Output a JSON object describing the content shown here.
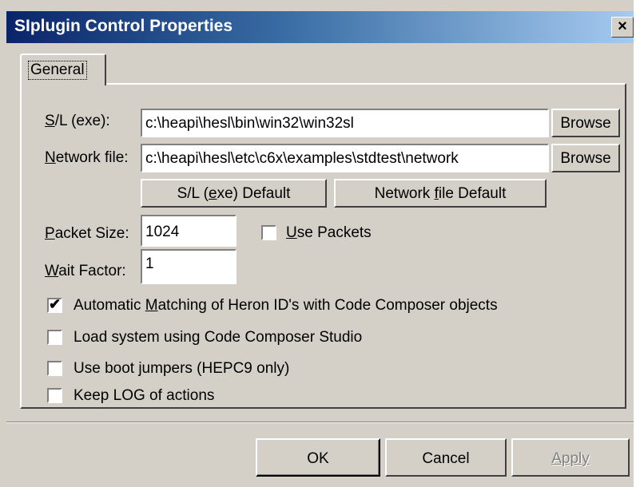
{
  "window": {
    "title": "SIplugin Control Properties",
    "close_label": "×"
  },
  "tabs": [
    {
      "label": "General"
    }
  ],
  "general": {
    "sl_exe": {
      "label_mnemonic": "S",
      "label_rest": "/L (exe):",
      "value": "c:\\heapi\\hesl\\bin\\win32\\win32sl",
      "browse_label": "Browse"
    },
    "network_file": {
      "label_mnemonic": "N",
      "label_rest": "etwork file:",
      "value": "c:\\heapi\\hesl\\etc\\c6x\\examples\\stdtest\\network",
      "browse_label": "Browse"
    },
    "sl_default_button": {
      "pre": "S/L (",
      "mnemonic": "e",
      "post": "xe) Default"
    },
    "network_default_button": {
      "pre": "Network ",
      "mnemonic": "f",
      "post": "ile Default"
    },
    "packet_size": {
      "label_mnemonic": "P",
      "label_rest": "acket Size:",
      "value": "1024"
    },
    "use_packets": {
      "label_mnemonic": "U",
      "label_rest": "se Packets",
      "checked": false
    },
    "wait_factor": {
      "label_mnemonic": "W",
      "label_rest": "ait Factor:",
      "value": "1"
    },
    "options": [
      {
        "pre": "Automatic ",
        "mnemonic": "M",
        "post": "atching of Heron ID's with Code Composer objects",
        "checked": true
      },
      {
        "pre": "Load system using Code Composer Studio",
        "mnemonic": "",
        "post": "",
        "checked": false
      },
      {
        "pre": "Use boot jumpers (HEPC9 only)",
        "mnemonic": "",
        "post": "",
        "checked": false
      },
      {
        "pre": "Keep LOG of actions",
        "mnemonic": "",
        "post": "",
        "checked": false
      }
    ],
    "check_mark": "✔"
  },
  "footer": {
    "ok_label": "OK",
    "cancel_label": "Cancel",
    "apply_label": "Apply",
    "apply_enabled": false
  }
}
